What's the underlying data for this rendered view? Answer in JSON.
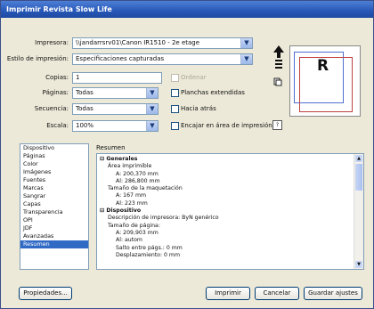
{
  "window": {
    "title": "Imprimir Revista Slow Life"
  },
  "form": {
    "printer_label": "Impresora:",
    "printer_value": "\\\\jandarrsrv01\\Canon IR1510 - 2e etage",
    "style_label": "Estilo de impresión:",
    "style_value": "Especificaciones capturadas",
    "copies_label": "Copias:",
    "copies_value": "1",
    "collate_label": "Ordenar",
    "pages_label": "Páginas:",
    "pages_value": "Todas",
    "spreads_label": "Planchas extendidas",
    "sequence_label": "Secuencia:",
    "sequence_value": "Todas",
    "backwards_label": "Hacia atrás",
    "scale_label": "Escala:",
    "scale_value": "100%",
    "fit_label": "Encajar en área de impresión",
    "help_label": "?"
  },
  "preview": {
    "letter": "R"
  },
  "panels": [
    "Dispositivo",
    "Páginas",
    "Color",
    "Imágenes",
    "Fuentes",
    "Marcas",
    "Sangrar",
    "Capas",
    "Transparencia",
    "OPI",
    "JDF",
    "Avanzadas",
    "Resumen"
  ],
  "summary": {
    "heading": "Resumen",
    "lines": [
      {
        "text": "⊟ Generales",
        "indent": 0,
        "bold": true
      },
      {
        "text": "Área imprimible",
        "indent": 1,
        "bold": false
      },
      {
        "text": "A: 200,370 mm",
        "indent": 2,
        "bold": false
      },
      {
        "text": "Al: 286,800 mm",
        "indent": 2,
        "bold": false
      },
      {
        "text": "Tamaño de la maquetación",
        "indent": 1,
        "bold": false
      },
      {
        "text": "A: 167 mm",
        "indent": 2,
        "bold": false
      },
      {
        "text": "Al: 223 mm",
        "indent": 2,
        "bold": false
      },
      {
        "text": "⊟ Dispositivo",
        "indent": 0,
        "bold": true
      },
      {
        "text": "Descripción de impresora: ByN genérico",
        "indent": 1,
        "bold": false
      },
      {
        "text": "Tamaño de página:",
        "indent": 1,
        "bold": false
      },
      {
        "text": "A: 209,903 mm",
        "indent": 2,
        "bold": false
      },
      {
        "text": "Al: autom",
        "indent": 2,
        "bold": false
      },
      {
        "text": "Salto entre págs.: 0 mm",
        "indent": 2,
        "bold": false
      },
      {
        "text": "Desplazamiento: 0 mm",
        "indent": 2,
        "bold": false
      }
    ]
  },
  "buttons": {
    "properties": "Propiedades...",
    "print": "Imprimir",
    "cancel": "Cancelar",
    "save": "Guardar ajustes"
  },
  "colors": {
    "title_bar": "#2858b8",
    "selection": "#316ac5"
  }
}
